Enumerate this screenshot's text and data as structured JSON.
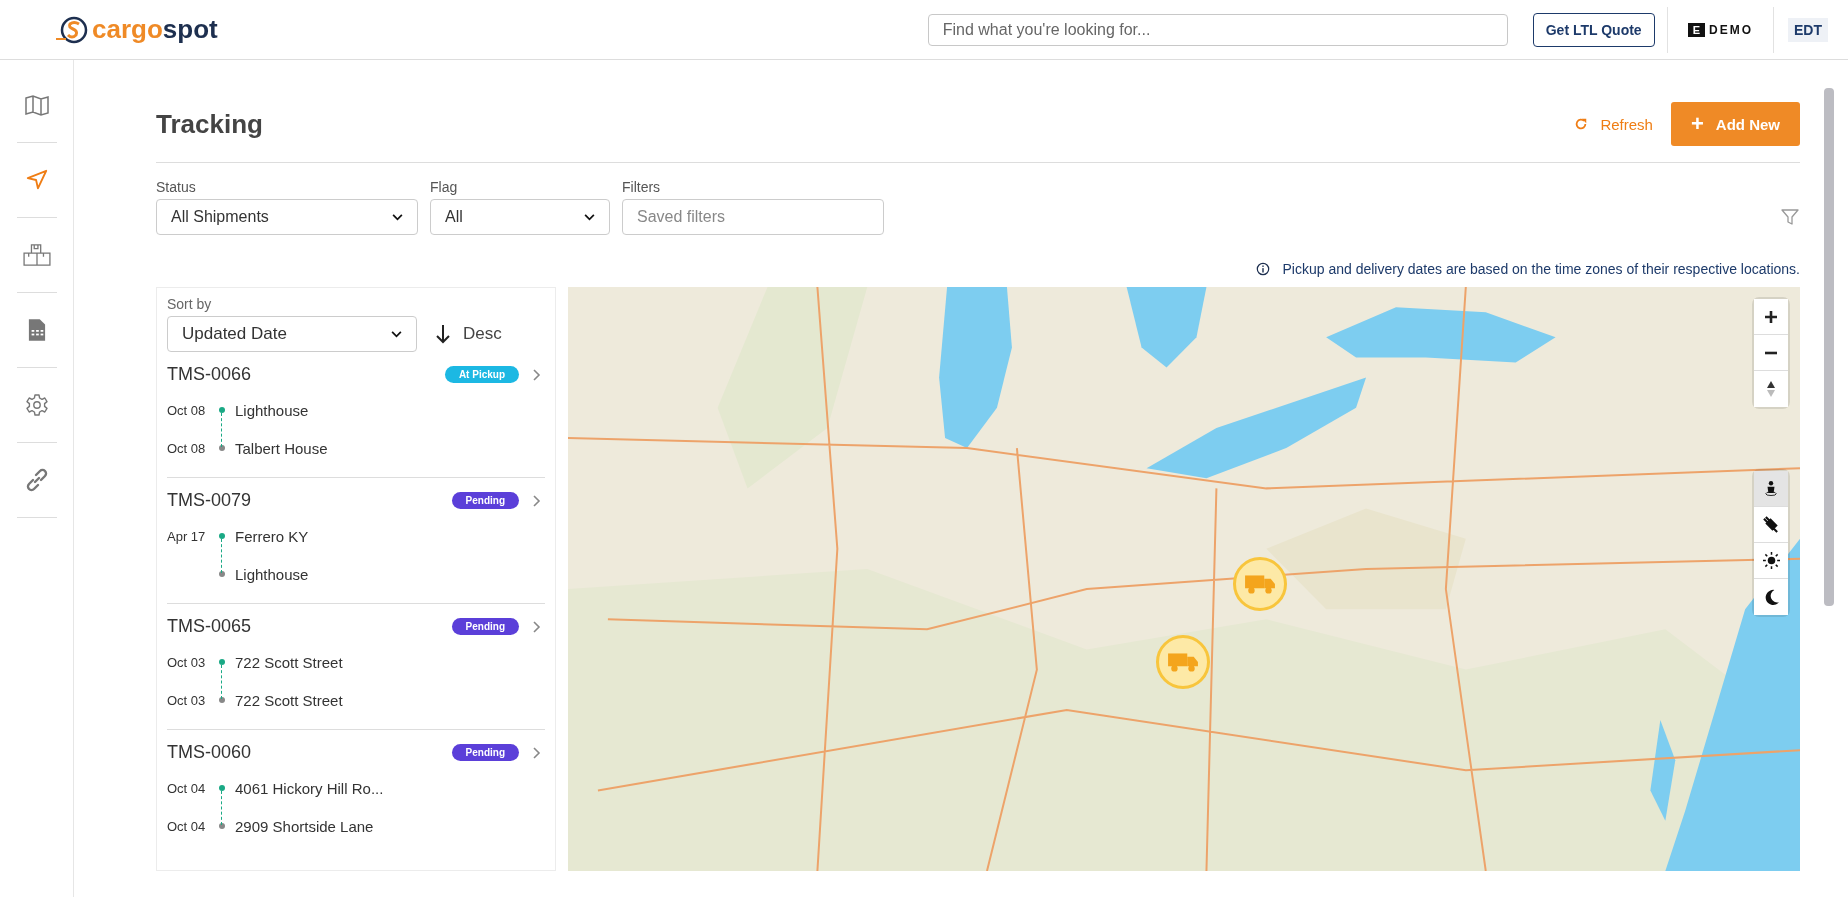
{
  "header": {
    "logo": {
      "part_1": "cargo",
      "part_2": "spot"
    },
    "search": {
      "placeholder": "Find what you're looking for..."
    },
    "quote_button": "Get LTL Quote",
    "company": {
      "mark": "E",
      "name": "DEMO"
    },
    "timezone": "EDT"
  },
  "sidebar": {
    "items": [
      {
        "kind": "map",
        "selected": false
      },
      {
        "kind": "navigate",
        "selected": true
      },
      {
        "kind": "boxes",
        "selected": false
      },
      {
        "kind": "sheet",
        "selected": false
      },
      {
        "kind": "settings",
        "selected": false
      },
      {
        "kind": "link",
        "selected": false
      }
    ]
  },
  "page": {
    "title": "Tracking",
    "refresh": "Refresh",
    "add_new": "Add New",
    "plus": "+"
  },
  "filters": [
    {
      "kind": "select",
      "label": "Status",
      "value": "All Shipments"
    },
    {
      "kind": "select",
      "label": "Flag",
      "value": "All"
    },
    {
      "kind": "input",
      "label": "Filters",
      "placeholder": "Saved filters"
    }
  ],
  "note": "Pickup and delivery dates are based on the time zones of their respective locations.",
  "sort": {
    "label": "Sort by",
    "value": "Updated Date",
    "direction": "Desc"
  },
  "shipments": [
    {
      "id": "TMS-0066",
      "status": {
        "label": "At Pickup",
        "color": "#1cb8e3"
      },
      "stops": [
        {
          "date": "Oct 08",
          "place": "Lighthouse"
        },
        {
          "date": "Oct 08",
          "place": "Talbert House"
        }
      ]
    },
    {
      "id": "TMS-0079",
      "status": {
        "label": "Pending",
        "color": "#5b3fd9"
      },
      "stops": [
        {
          "date": "Apr 17",
          "place": "Ferrero KY"
        },
        {
          "place": "Lighthouse"
        }
      ]
    },
    {
      "id": "TMS-0065",
      "status": {
        "label": "Pending",
        "color": "#5b3fd9"
      },
      "stops": [
        {
          "date": "Oct 03",
          "place": "722 Scott Street"
        },
        {
          "date": "Oct 03",
          "place": "722 Scott Street"
        }
      ]
    },
    {
      "id": "TMS-0060",
      "status": {
        "label": "Pending",
        "color": "#5b3fd9"
      },
      "stops": [
        {
          "date": "Oct 04",
          "place": "4061 Hickory Hill Ro..."
        },
        {
          "date": "Oct 04",
          "place": "2909 Shortside Lane"
        }
      ]
    }
  ],
  "map": {
    "styles": [
      {
        "kind": "terrain",
        "selected": true
      },
      {
        "kind": "satellite",
        "selected": false
      },
      {
        "kind": "light",
        "selected": false
      },
      {
        "kind": "dark",
        "selected": false
      }
    ]
  }
}
